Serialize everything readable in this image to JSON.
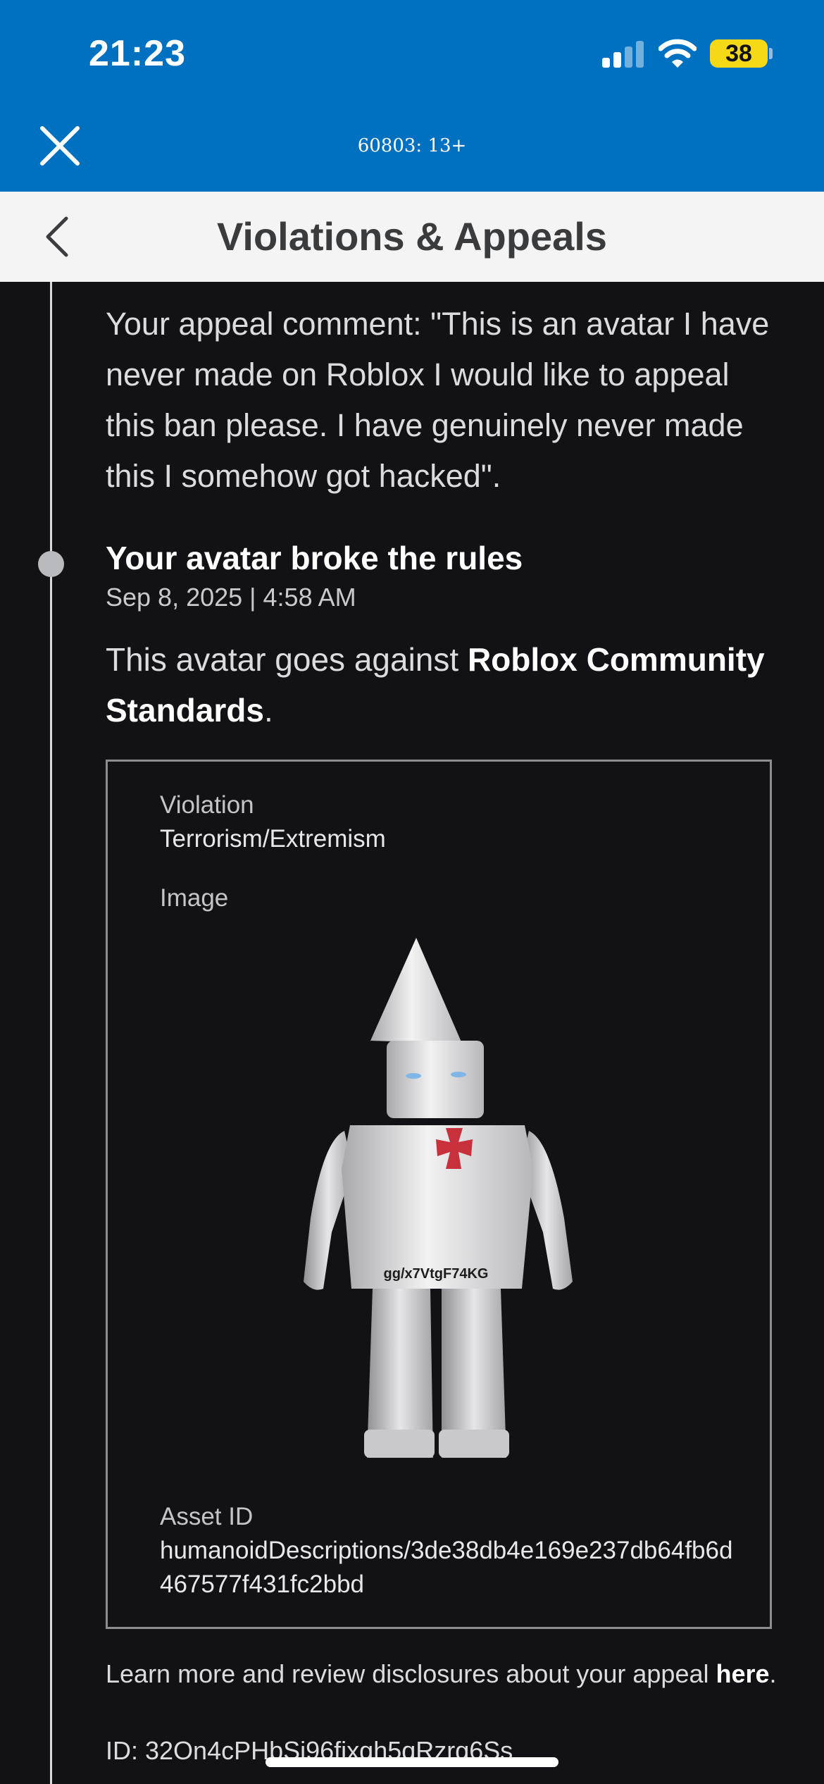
{
  "status_bar": {
    "time": "21:23",
    "battery": "38"
  },
  "webview": {
    "title": "60803: 13+"
  },
  "header": {
    "title": "Violations & Appeals"
  },
  "appeal": {
    "comment": "Your appeal comment: \"This is an avatar I have never made on Roblox I would like to appeal this ban please. I have genuinely never made this I somehow got hacked\"."
  },
  "event": {
    "title": "Your avatar broke the rules",
    "date": "Sep 8, 2025 | 4:58 AM",
    "desc_prefix": "This avatar goes against ",
    "desc_link": "Roblox Community Standards",
    "desc_suffix": "."
  },
  "card": {
    "violation_label": "Violation",
    "violation_value": "Terrorism/Extremism",
    "image_label": "Image",
    "avatar_shirt_text": "gg/x7VtgF74KG",
    "asset_label": "Asset ID",
    "asset_value": "humanoidDescriptions/3de38db4e169e237db64fb6d467577f431fc2bbd"
  },
  "footer": {
    "text": "Learn more and review disclosures about your appeal ",
    "link": "here",
    "link_suffix": ".",
    "id": "ID: 32On4cPHbSj96fixgh5qRzrg6Ss"
  },
  "colors": {
    "status_blue": "#0070c0",
    "background": "#121216",
    "header_bg": "#f4f4f5",
    "battery_yellow": "#f5d816"
  }
}
